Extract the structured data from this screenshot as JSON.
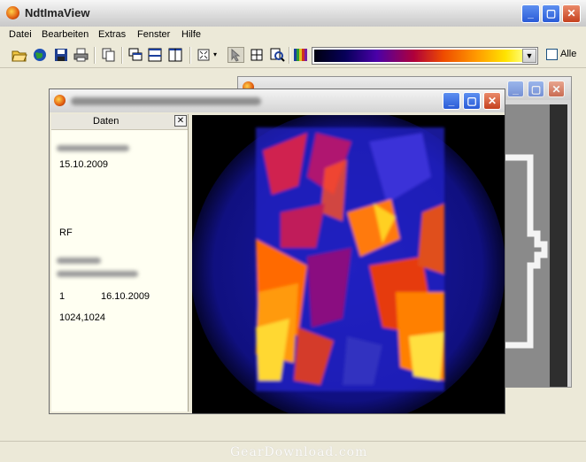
{
  "app": {
    "title": "NdtImaView"
  },
  "menu": [
    {
      "label": "Datei"
    },
    {
      "label": "Bearbeiten"
    },
    {
      "label": "Extras"
    },
    {
      "label": "Fenster"
    },
    {
      "label": "Hilfe"
    }
  ],
  "toolbar": {
    "checkbox_label": "Alle",
    "palette": [
      "#000010",
      "#07005a",
      "#4a00a8",
      "#b0003a",
      "#ee4b00",
      "#ff9a00",
      "#ffe300",
      "#fffb6e"
    ]
  },
  "data_panel": {
    "title": "Daten",
    "close_label": "✕",
    "fields": [
      {
        "value": "15.10.2009"
      },
      {
        "value": "RF"
      },
      {
        "value": "1"
      },
      {
        "value": "16.10.2009"
      },
      {
        "value": "1024,1024"
      }
    ]
  },
  "status": {
    "watermark": "GearDownload.com"
  },
  "colors": {
    "accent": "#2a5bd7",
    "close": "#c5411e",
    "panel_bg": "#fffff2"
  }
}
